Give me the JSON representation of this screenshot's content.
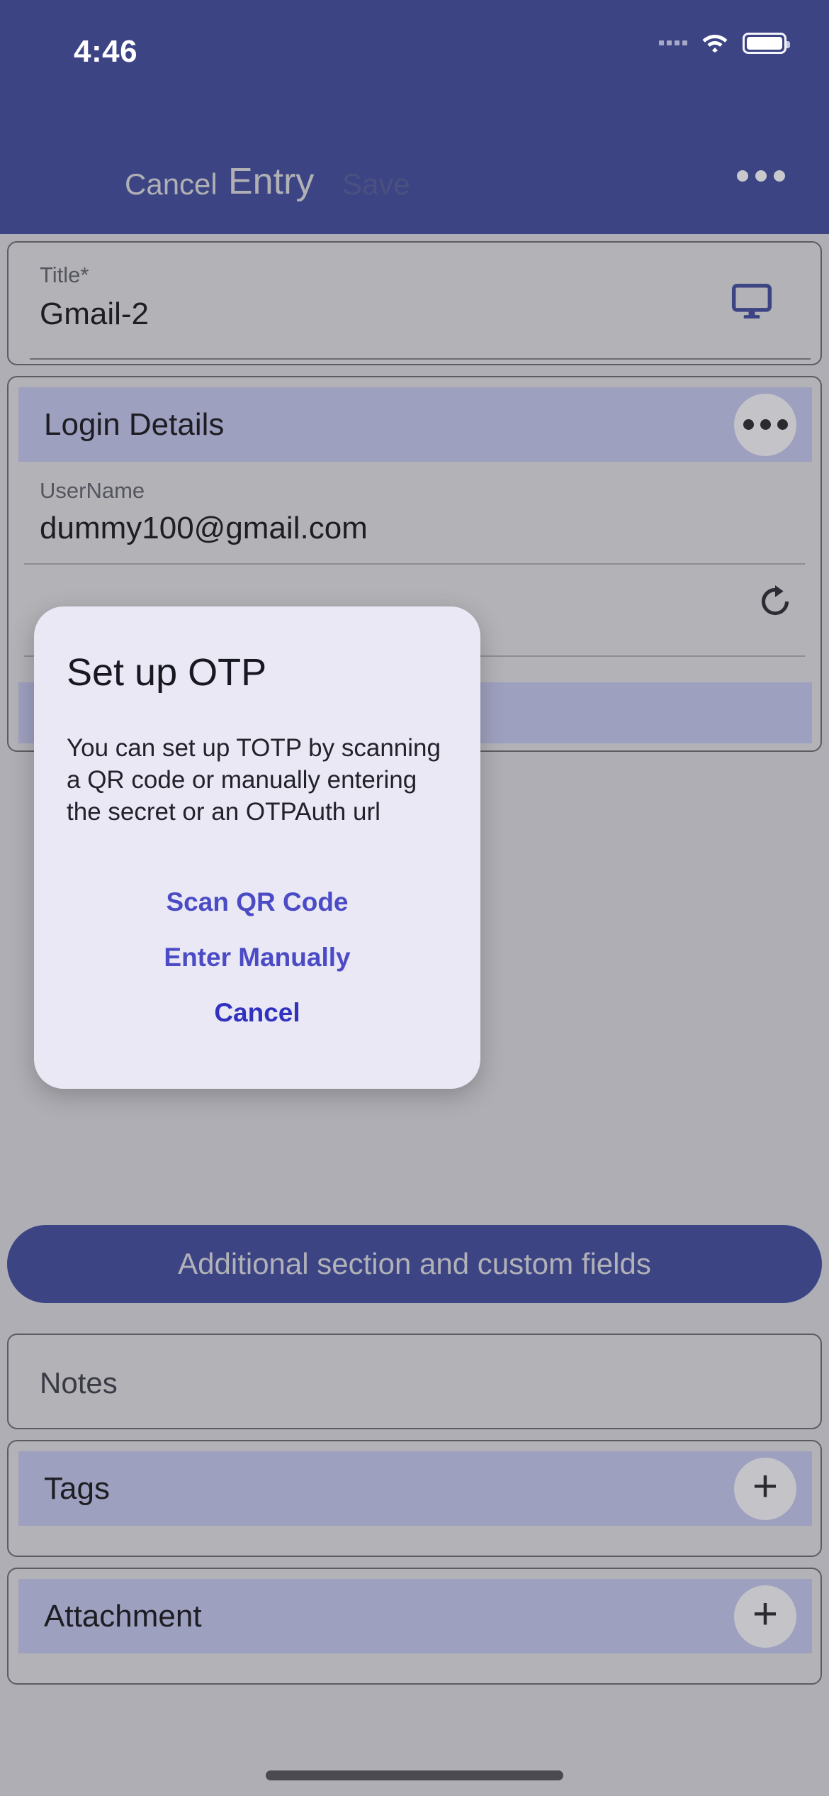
{
  "status_bar": {
    "time": "4:46",
    "signal_icon": "signal-dots-icon",
    "wifi_icon": "wifi-icon",
    "battery_icon": "battery-full-icon"
  },
  "navbar": {
    "cancel_label": "Cancel",
    "title": "Entry",
    "save_label": "Save",
    "more_icon": "more-horizontal-icon"
  },
  "title_card": {
    "label": "Title*",
    "value": "Gmail-2",
    "icon": "monitor-icon",
    "icon_color": "#3c4484"
  },
  "login_section": {
    "header": "Login Details",
    "menu_icon": "more-horizontal-icon",
    "username_label": "UserName",
    "username_value": "dummy100@gmail.com",
    "regenerate_icon": "refresh-icon"
  },
  "additional_button": {
    "label": "Additional section and custom fields"
  },
  "notes_card": {
    "label": "Notes"
  },
  "tags_card": {
    "label": "Tags",
    "add_icon": "plus-icon"
  },
  "attachment_card": {
    "label": "Attachment",
    "add_icon": "plus-icon"
  },
  "dialog": {
    "title": "Set up OTP",
    "message": "You can set up TOTP by scanning a QR code or manually entering the secret or an OTPAuth url",
    "buttons": [
      {
        "label": "Scan QR Code"
      },
      {
        "label": "Enter Manually"
      },
      {
        "label": "Cancel"
      }
    ]
  },
  "colors": {
    "header_blue": "#3c4484",
    "page_bg": "#aeaeb4",
    "card_bg": "#b2b2b7",
    "section_strip": "#9ea0bf",
    "dialog_bg": "#e9e8f4",
    "dialog_action_blue": "#4b4bc6"
  }
}
